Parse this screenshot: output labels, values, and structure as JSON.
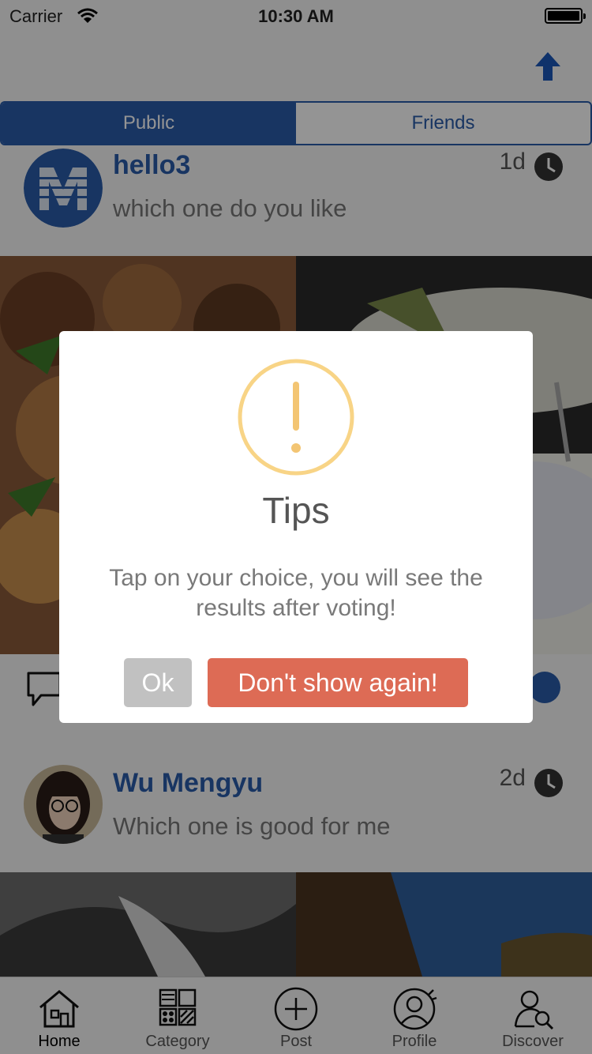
{
  "status_bar": {
    "carrier": "Carrier",
    "time": "10:30 AM"
  },
  "segmented": {
    "tabs": [
      "Public",
      "Friends"
    ],
    "selected": "Public"
  },
  "posts": [
    {
      "username": "hello3",
      "question": "which one do you like",
      "time": "1d"
    },
    {
      "username": "Wu Mengyu",
      "question": "Which one is good for me",
      "time": "2d"
    }
  ],
  "tab_bar": {
    "items": [
      {
        "label": "Home",
        "icon": "home-icon"
      },
      {
        "label": "Category",
        "icon": "category-icon"
      },
      {
        "label": "Post",
        "icon": "plus-circle-icon"
      },
      {
        "label": "Profile",
        "icon": "profile-icon"
      },
      {
        "label": "Discover",
        "icon": "discover-icon"
      }
    ],
    "selected": "Home"
  },
  "dialog": {
    "title": "Tips",
    "message": "Tap on your choice, you will see the results after voting!",
    "ok_label": "Ok",
    "dont_show_label": "Don't show again!"
  },
  "colors": {
    "accent": "#2a5caa",
    "warning": "#f8d486",
    "confirm": "#dd6b55",
    "cancel": "#c1c1c1"
  }
}
